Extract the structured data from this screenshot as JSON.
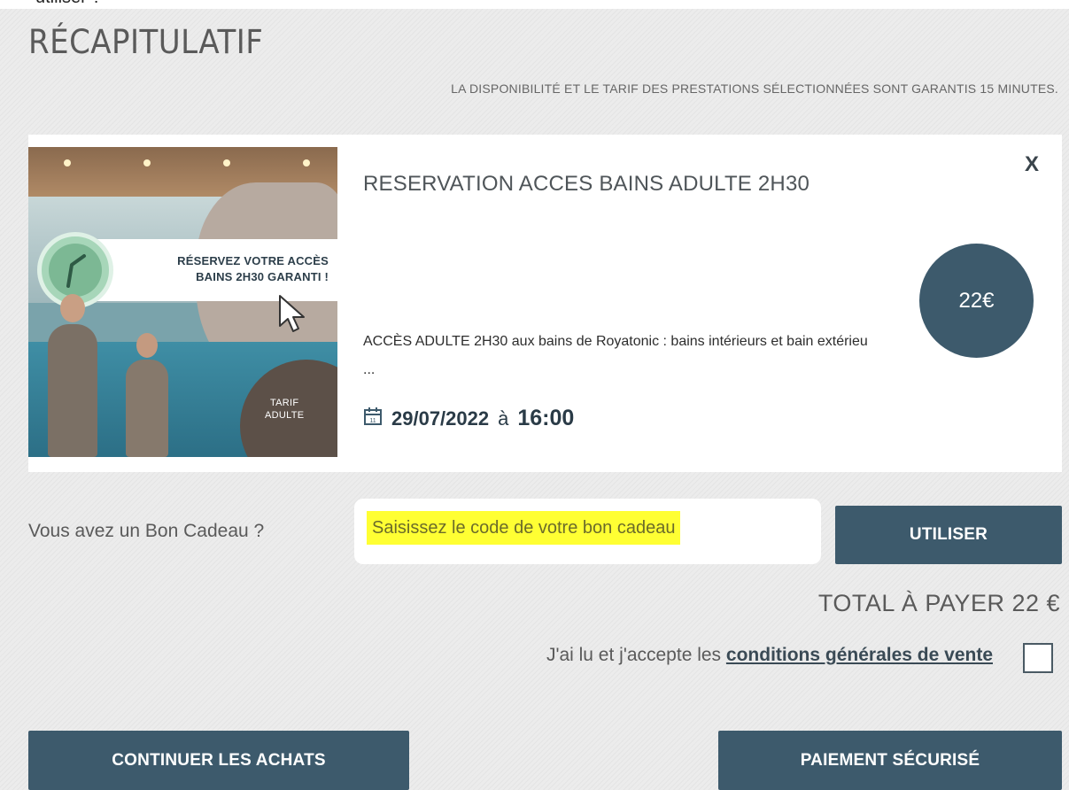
{
  "cropped_header": {
    "text": "utiliser ?"
  },
  "summary": {
    "title": "RÉCAPITULATIF",
    "notice": "LA DISPONIBILITÉ ET LE TARIF DES PRESTATIONS SÉLECTIONNÉES SONT GARANTIS 15 MINUTES."
  },
  "product": {
    "image": {
      "banner_line1": "RÉSERVEZ VOTRE ACCÈS",
      "banner_line2": "BAINS 2H30 GARANTI !",
      "badge_line1": "TARIF",
      "badge_line2": "ADULTE"
    },
    "title": "RESERVATION ACCES BAINS ADULTE 2H30",
    "remove_label": "X",
    "price": "22€",
    "description": "ACCÈS ADULTE 2H30 aux bains de Royatonic : bains intérieurs et bain extérieu ...",
    "date": "29/07/2022",
    "date_sep": "à",
    "time": "16:00",
    "calendar_icon": "calendar-icon"
  },
  "gift": {
    "label": "Vous avez un Bon Cadeau ?",
    "placeholder": "Saisissez le code de votre bon cadeau",
    "button": "UTILISER"
  },
  "total": {
    "text": "TOTAL À PAYER 22 €"
  },
  "terms": {
    "prefix": "J'ai lu et j'accepte les ",
    "link": "conditions générales de vente",
    "checked": false
  },
  "actions": {
    "continue": "CONTINUER LES ACHATS",
    "pay": "PAIEMENT SÉCURISÉ"
  },
  "colors": {
    "primary": "#3d5a6c",
    "highlight": "#ffff33",
    "background": "#ececec"
  }
}
